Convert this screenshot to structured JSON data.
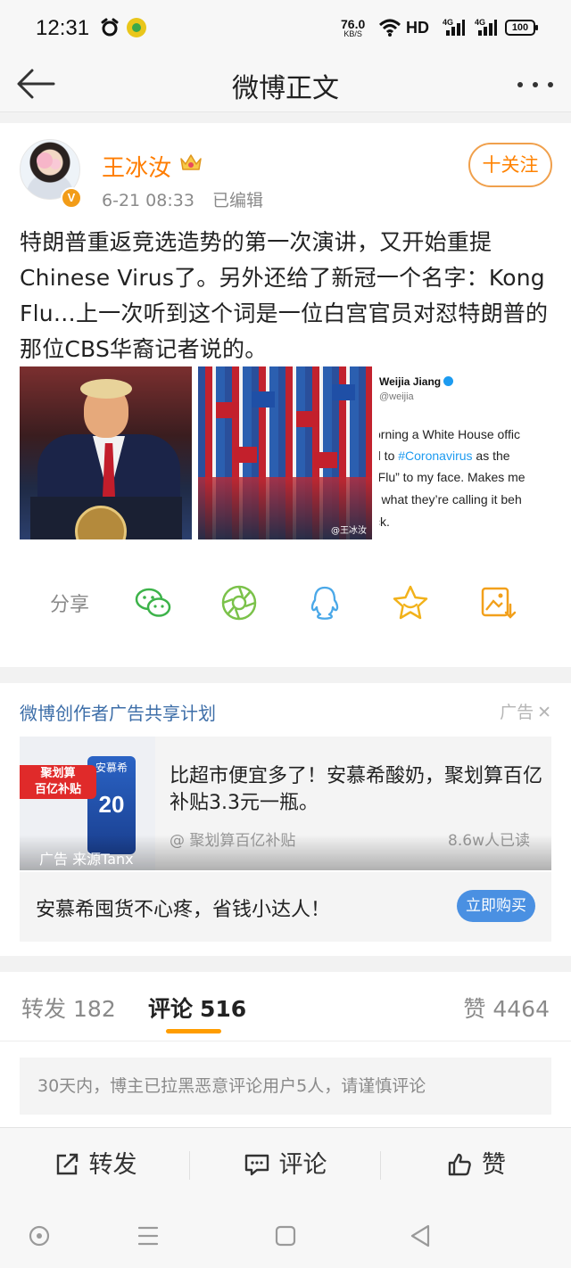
{
  "status_bar": {
    "time": "12:31",
    "net_speed": "76.0",
    "net_unit": "KB/S",
    "hd": "HD",
    "signal_label": "4G",
    "battery": "100"
  },
  "header": {
    "title": "微博正文"
  },
  "post": {
    "username": "王冰汝",
    "date": "6-21 08:33",
    "edited": "已编辑",
    "follow": "十关注",
    "text": "特朗普重返竞选造势的第一次演讲，又开始重提Chinese Virus了。另外还给了新冠一个名字：Kong Flu…上一次听到这个词是一位白宫官员对怼特朗普的那位CBS华裔记者说的。",
    "images": {
      "watermark": "@王冰汝",
      "tweet_name": "Weijia Jiang",
      "tweet_handle": "@weijia",
      "tweet_l1": "orning a White House offic",
      "tweet_l2_pre": "d to ",
      "tweet_l2_tag": "#Coronavirus",
      "tweet_l2_post": " as the",
      "tweet_l3": "-Flu” to my face. Makes me",
      "tweet_l4": "r what they’re calling it beh",
      "tweet_l5": "ck."
    },
    "share_label": "分享"
  },
  "ad": {
    "plan": "微博创作者广告共享计划",
    "tag": "广告",
    "badge_line1": "聚划算",
    "badge_line2": "百亿补贴",
    "product_brand": "安慕希",
    "product_number": "20",
    "headline": "比超市便宜多了！安慕希酸奶，聚划算百亿补贴3.3元一瓶。",
    "source": "@ 聚划算百亿补贴",
    "reads": "8.6w人已读",
    "overlay": "广告 来源Tanx",
    "footer_text": "安慕希囤货不心疼，省钱小达人！",
    "buy_button": "立即购买"
  },
  "tabs": {
    "repost_label": "转发",
    "repost_count": "182",
    "comment_label": "评论",
    "comment_count": "516",
    "like_label": "赞",
    "like_count": "4464"
  },
  "comments": {
    "notice": "30天内，博主已拉黑恶意评论用户5人，请谨慎评论"
  },
  "actions": {
    "repost": "转发",
    "comment": "评论",
    "like": "赞"
  },
  "colors": {
    "accent": "#ff8200",
    "link": "#3d6ea8",
    "tab_indicator": "#ff9d00",
    "buy_button": "#4a90e2"
  },
  "icons": [
    "back-arrow-icon",
    "more-icon",
    "verified-badge-icon",
    "crown-icon",
    "wechat-icon",
    "moments-icon",
    "qq-icon",
    "favorite-star-icon",
    "save-image-icon",
    "close-icon",
    "repost-icon",
    "comment-icon",
    "like-icon"
  ]
}
